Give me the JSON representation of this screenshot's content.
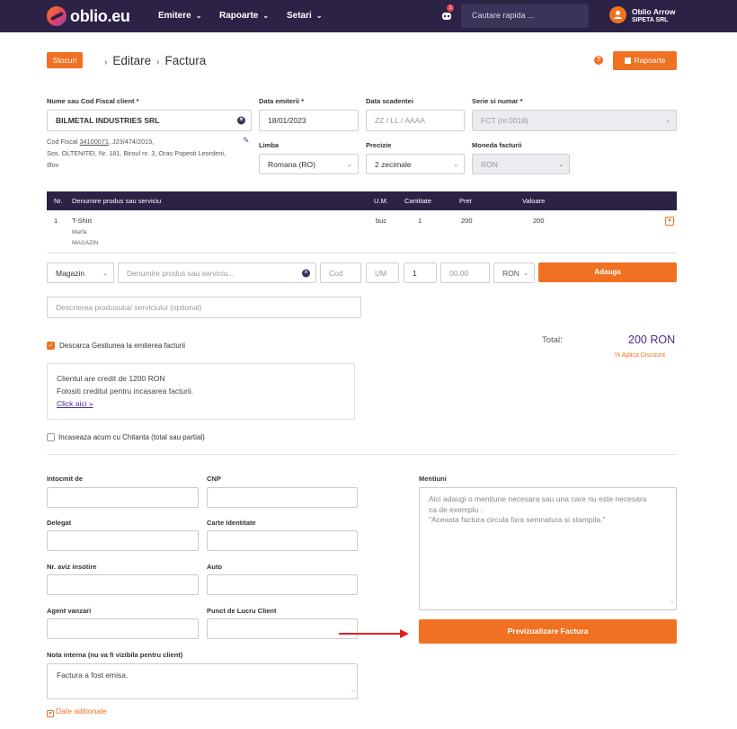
{
  "nav": {
    "logo": "oblio.eu",
    "menu": [
      {
        "label": "Emitere"
      },
      {
        "label": "Rapoarte"
      },
      {
        "label": "Setari"
      }
    ],
    "notification_count": "1",
    "search_placeholder": "Cautare rapida ...",
    "user_name": "Oblio Arrow",
    "user_company": "SIPETA SRL"
  },
  "header": {
    "tag": "Stocuri",
    "breadcrumb": [
      "Editare",
      "Factura"
    ],
    "reports_button": "Rapoarte",
    "help": "?"
  },
  "form": {
    "client_label": "Nume sau Cod Fiscal client *",
    "client_value": "BILMETAL INDUSTRIES SRL",
    "client_info_line1_prefix": "Cod Fiscal",
    "client_cif": "34100071",
    "client_info_line1_suffix": ", J23/474/2015,",
    "client_info_line2": "Sos. OLTENITEI, Nr. 181, Biroul nr. 3, Oras Popesti Leordeni,",
    "client_info_line3": "Ilfov",
    "issue_date_label": "Data emiterii *",
    "issue_date_value": "18/01/2023",
    "due_date_label": "Data scadentei",
    "due_date_placeholder": "ZZ / LL / AAAA",
    "series_label": "Serie si numar *",
    "series_value": "FCT (nr.0018)",
    "language_label": "Limba",
    "language_value": "Romana (RO)",
    "precision_label": "Precizie",
    "precision_value": "2 zecimale",
    "currency_label": "Moneda facturii",
    "currency_value": "RON"
  },
  "table": {
    "headers": [
      "Nr.",
      "Denumire produs sau serviciu",
      "U.M.",
      "Cantitate",
      "Pret",
      "Valoare"
    ],
    "rows": [
      {
        "nr": "1",
        "name": "T-Shirt",
        "sub1": "Marfa",
        "sub2": "MAGAZIN",
        "um": "buc",
        "qty": "1",
        "price": "200",
        "value": "200"
      }
    ]
  },
  "add_row": {
    "warehouse": "Magazin",
    "product_placeholder": "Denumire produs sau serviciu...",
    "code_placeholder": "Cod",
    "um_placeholder": "UM",
    "qty_value": "1",
    "price_placeholder": "00.00",
    "currency": "RON",
    "add_button": "Adauga",
    "description_placeholder": "Descrierea produsului/ serviciului (optional)"
  },
  "stock": {
    "checkbox_label": "Descarca Gestiunea la emiterea facturii"
  },
  "totals": {
    "label": "Total:",
    "value": "200 RON",
    "discount_link": "% Aplica Discount"
  },
  "credit": {
    "line1": "Clientul are credit de 1200 RON",
    "line2": "Folositi creditul pentru incasarea facturii.",
    "link": "Click aici »"
  },
  "receipt": {
    "checkbox_label": "Incaseaza acum cu Chitanta (total sau partial)"
  },
  "details": {
    "issued_by": "Intocmit de",
    "cnp": "CNP",
    "delegate": "Delegat",
    "id_card": "Carte Identitate",
    "notice_no": "Nr. aviz insotire",
    "auto": "Auto",
    "sales_agent": "Agent vanzari",
    "work_point": "Punct de Lucru Client",
    "internal_note_label": "Nota interna (nu va fi vizibila pentru client)",
    "internal_note_value": "Factura a fost emisa.",
    "mentions_label": "Mentiuni",
    "mentions_placeholder_line1": "Aici adaugi o mentiune necesara sau una care nu este necesara",
    "mentions_placeholder_line2": "ca de exemplu :",
    "mentions_placeholder_line3": "\"Aceasta factura circula fara semnatura si stampila.\"",
    "preview_button": "Previzualizare Factura",
    "additional_dates": "Date aditionale"
  },
  "colors": {
    "nav": "#2b2246",
    "accent": "#f07122",
    "total": "#4a2b8a",
    "arrow": "#e02020"
  }
}
